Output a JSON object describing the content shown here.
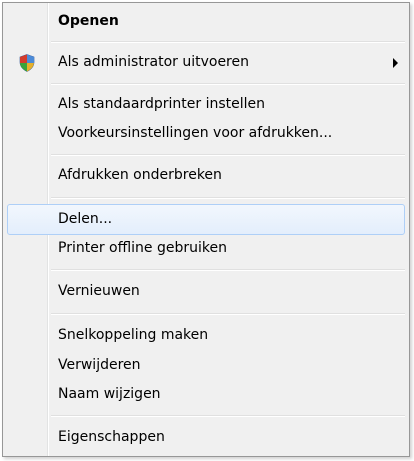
{
  "menu": {
    "items": [
      {
        "label": "Openen"
      },
      {
        "label": "Als administrator uitvoeren",
        "icon": "uac-shield-icon",
        "submenu": true
      },
      {
        "label": "Als standaardprinter instellen"
      },
      {
        "label": "Voorkeursinstellingen voor afdrukken..."
      },
      {
        "label": "Afdrukken onderbreken"
      },
      {
        "label": "Delen..."
      },
      {
        "label": "Printer offline gebruiken"
      },
      {
        "label": "Vernieuwen"
      },
      {
        "label": "Snelkoppeling maken"
      },
      {
        "label": "Verwijderen"
      },
      {
        "label": "Naam wijzigen"
      },
      {
        "label": "Eigenschappen"
      }
    ],
    "colors": {
      "highlight_border": "#aecff7",
      "highlight_fill": "#e3eefc",
      "background": "#f0f0f0"
    }
  }
}
